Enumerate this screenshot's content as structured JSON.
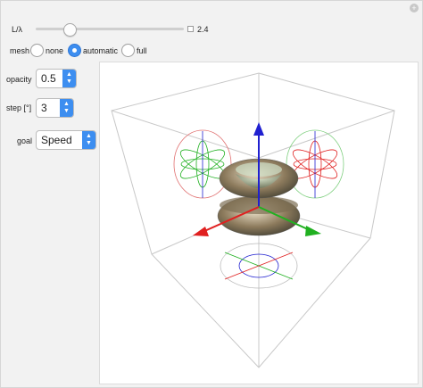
{
  "controls": {
    "length_label": "L/λ",
    "length_value": "2.4",
    "length_fraction": 0.23,
    "mesh_label": "mesh",
    "mesh_options": [
      "none",
      "automatic",
      "full"
    ],
    "mesh_selected": "automatic",
    "opacity_label": "opacity",
    "opacity_value": "0.5",
    "step_label": "step [°]",
    "step_value": "3",
    "goal_label": "goal",
    "goal_value": "Speed"
  },
  "icons": {
    "plus": "plus-icon",
    "stepper": "chevron-updown-icon"
  },
  "colors": {
    "accent": "#3d8ef0",
    "axis_x": "#e02020",
    "axis_y": "#20b020",
    "axis_z": "#2020d0"
  }
}
